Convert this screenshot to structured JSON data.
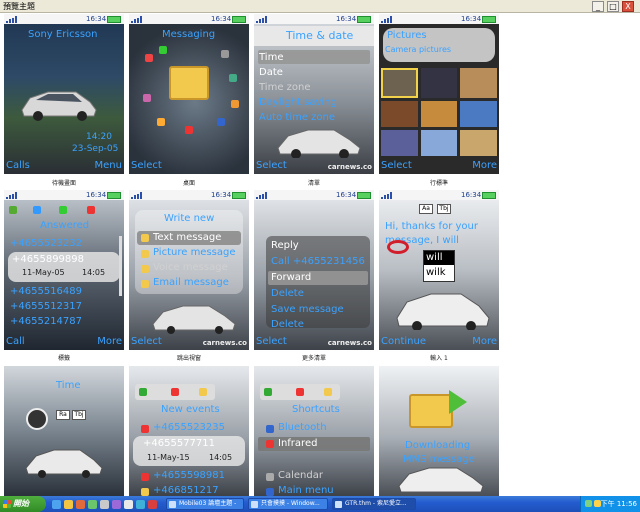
{
  "window": {
    "title": "預覽主題",
    "buttons": [
      "_",
      "□",
      "X"
    ]
  },
  "status": {
    "time": "16:34"
  },
  "tiles": [
    {
      "caption": "待機畫面",
      "texts": {
        "operator": "Sony Ericsson",
        "clock": "14:20",
        "date": "23-Sep-05",
        "soft_left": "Calls",
        "soft_right": "Menu"
      }
    },
    {
      "caption": "桌面",
      "texts": {
        "title": "Messaging",
        "soft_left": "Select"
      }
    },
    {
      "caption": "清單",
      "texts": {
        "title": "Time & date",
        "items": [
          "Time",
          "Date",
          "Time zone",
          "Daylight saving",
          "Auto time zone"
        ],
        "soft_left": "Select",
        "watermark": "carnews.co"
      }
    },
    {
      "caption": "行標準",
      "texts": {
        "title": "Pictures",
        "subtitle": "Camera pictures",
        "soft_left": "Select",
        "soft_right": "More"
      }
    },
    {
      "caption": "標籤",
      "texts": {
        "title": "Answered",
        "items": [
          "+4655523232",
          "+4655899898",
          "11-May-05",
          "14:05",
          "+4655516489",
          "+4655512317",
          "+4655214787"
        ],
        "soft_left": "Call",
        "soft_right": "More"
      }
    },
    {
      "caption": "跳出視窗",
      "texts": {
        "title": "Write new",
        "items": [
          "Text message",
          "Picture message",
          "Voice message",
          "Email message"
        ],
        "soft_left": "Select",
        "watermark": "carnews.co"
      }
    },
    {
      "caption": "更多清單",
      "texts": {
        "items": [
          "Reply",
          "Call +4655231456",
          "Forward",
          "Delete",
          "Save message",
          "Delete"
        ],
        "soft_left": "Select",
        "watermark": "carnews.co"
      }
    },
    {
      "caption": "輸入 1",
      "texts": {
        "title": "Hi, thanks for your message, I will",
        "suggestions": [
          "will",
          "wilk"
        ],
        "soft_left": "Continue",
        "soft_right": "More"
      }
    },
    {
      "caption": "",
      "texts": {
        "title": "Time",
        "tag_a": "Ra",
        "tag_b": "Tbj"
      }
    },
    {
      "caption": "",
      "texts": {
        "title": "New events",
        "items": [
          "+4655523235",
          "+4655577711",
          "11-May-15",
          "14:05",
          "+4655598981",
          "+466851217"
        ]
      }
    },
    {
      "caption": "",
      "texts": {
        "title": "Shortcuts",
        "items": [
          "Bluetooth",
          "Infrared",
          "Calendar",
          "Main menu"
        ]
      }
    },
    {
      "caption": "",
      "texts": {
        "title": "Downloading",
        "subtitle": "MMS message"
      }
    }
  ],
  "taskbar": {
    "start": "開始",
    "tasks": [
      "Mobile03 論壇主題 -",
      "只會摸摸 - Window...",
      "GTR.thm - 索尼愛立..."
    ],
    "time": "下午 11:56"
  },
  "colors": {
    "accent": "#3aa2ff",
    "titlebar": "#ece9d8",
    "taskbar": "#245ccf",
    "start": "#318b26"
  }
}
